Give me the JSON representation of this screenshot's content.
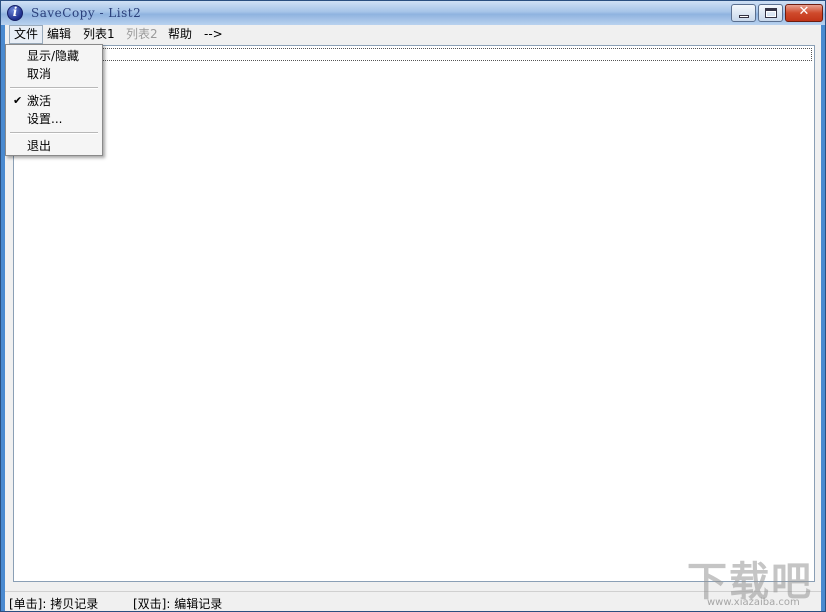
{
  "window": {
    "title": "SaveCopy - List2",
    "icon": "info-icon",
    "icon_letter": "i",
    "close_glyph": "✕"
  },
  "menubar": {
    "items": [
      {
        "label": "文件",
        "state": "open"
      },
      {
        "label": "编辑",
        "state": "normal"
      },
      {
        "label": "列表1",
        "state": "normal"
      },
      {
        "label": "列表2",
        "state": "disabled"
      },
      {
        "label": "帮助",
        "state": "normal"
      },
      {
        "label": "-->",
        "state": "normal"
      }
    ]
  },
  "file_menu": {
    "items": [
      {
        "label": "显示/隐藏",
        "checked": false
      },
      {
        "label": "取消",
        "checked": false
      },
      {
        "label": "激活",
        "checked": true
      },
      {
        "label": "设置...",
        "checked": false
      },
      {
        "label": "退出",
        "checked": false
      }
    ],
    "check_glyph": "✔"
  },
  "statusbar": {
    "left": "[单击]: 拷贝记录",
    "right": "[双击]: 编辑记录"
  },
  "watermark": {
    "text": "下载吧",
    "url": "www.xiazaiba.com"
  }
}
